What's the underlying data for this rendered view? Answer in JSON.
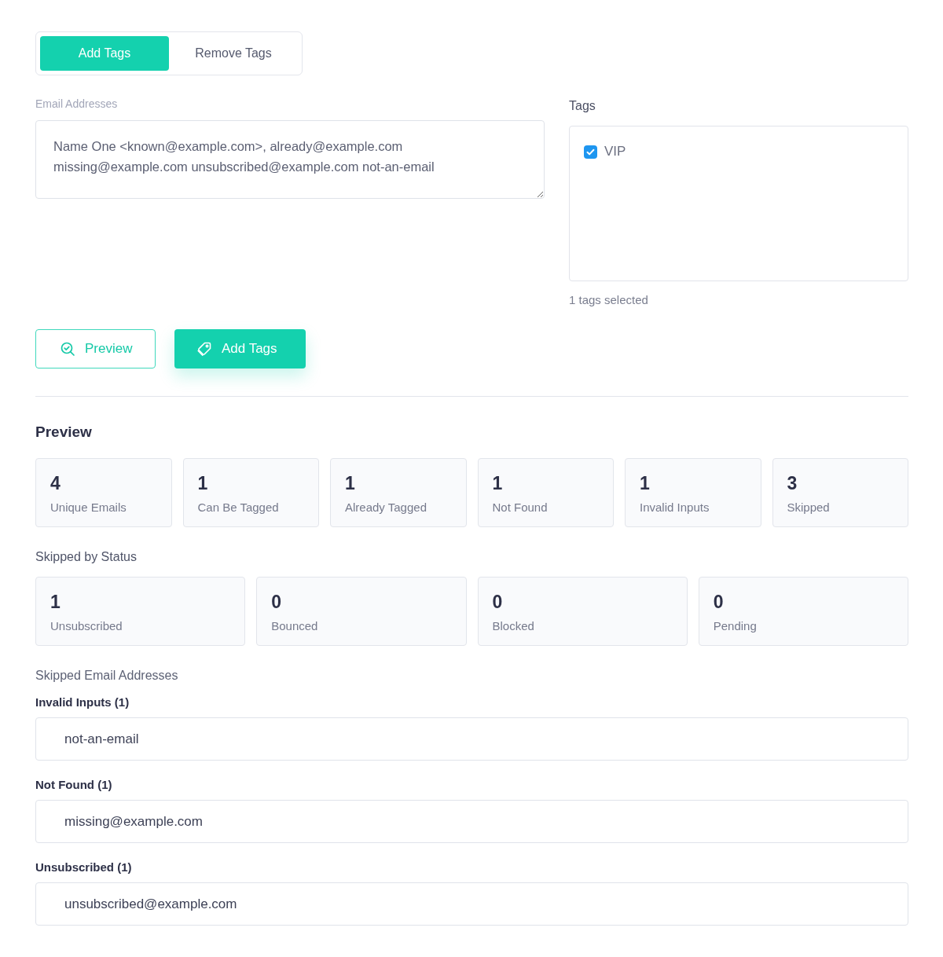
{
  "mode_tabs": [
    {
      "label": "Add Tags",
      "selected": true
    },
    {
      "label": "Remove Tags",
      "selected": false
    }
  ],
  "email_input": {
    "label": "Email Addresses",
    "value": "Name One <known@example.com>, already@example.com missing@example.com unsubscribed@example.com not-an-email"
  },
  "tags": {
    "label": "Tags",
    "items": [
      {
        "label": "VIP",
        "checked": true
      }
    ],
    "summary": "1 tags selected"
  },
  "actions": [
    {
      "kind": "outline",
      "label": "Preview"
    },
    {
      "kind": "primary",
      "label": "Add Tags"
    }
  ],
  "preview": {
    "title": "Preview",
    "stats": [
      {
        "value": "4",
        "label": "Unique Emails"
      },
      {
        "value": "1",
        "label": "Can Be Tagged"
      },
      {
        "value": "1",
        "label": "Already Tagged"
      },
      {
        "value": "1",
        "label": "Not Found"
      },
      {
        "value": "1",
        "label": "Invalid Inputs"
      },
      {
        "value": "3",
        "label": "Skipped"
      }
    ],
    "skipped_by_status": {
      "title": "Skipped by Status",
      "stats": [
        {
          "value": "1",
          "label": "Unsubscribed"
        },
        {
          "value": "0",
          "label": "Bounced"
        },
        {
          "value": "0",
          "label": "Blocked"
        },
        {
          "value": "0",
          "label": "Pending"
        }
      ]
    },
    "skipped_emails": {
      "title": "Skipped Email Addresses",
      "groups": [
        {
          "label": "Invalid Inputs (1)",
          "emails": [
            "not-an-email"
          ]
        },
        {
          "label": "Not Found (1)",
          "emails": [
            "missing@example.com"
          ]
        },
        {
          "label": "Unsubscribed (1)",
          "emails": [
            "unsubscribed@example.com"
          ]
        }
      ]
    }
  }
}
